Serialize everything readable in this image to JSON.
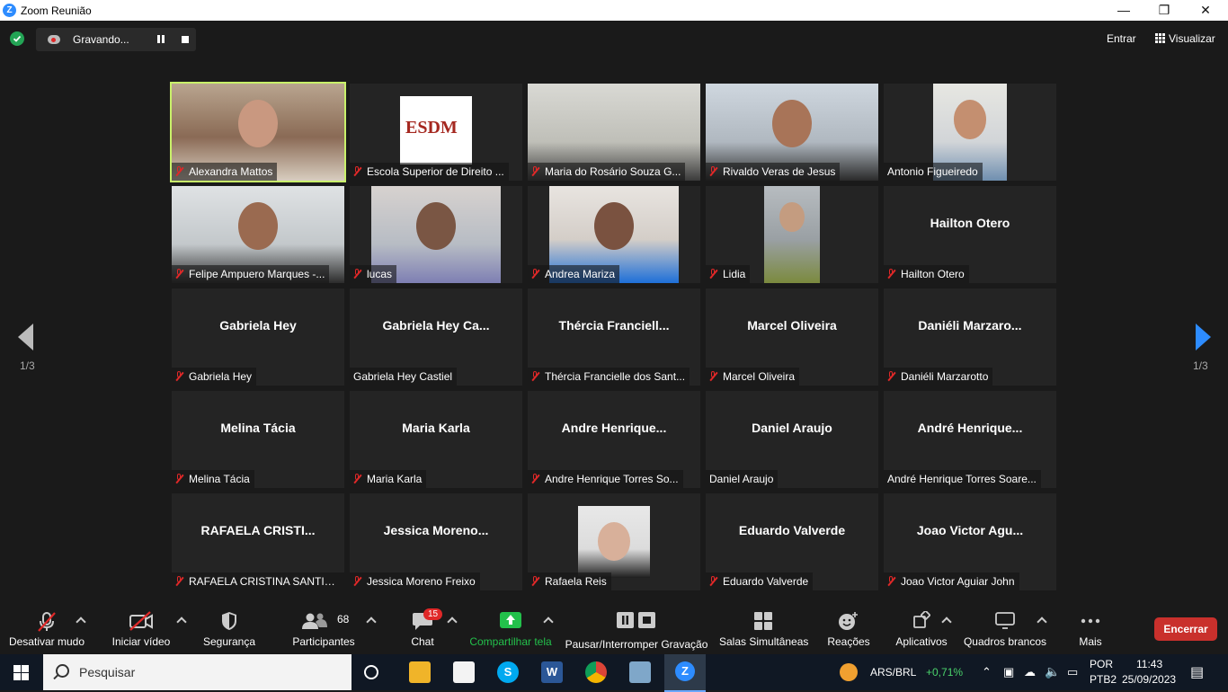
{
  "window": {
    "title": "Zoom Reunião"
  },
  "topbar": {
    "recording_label": "Gravando...",
    "enter_label": "Entrar",
    "view_label": "Visualizar"
  },
  "pagination": {
    "left": "1/3",
    "right": "1/3"
  },
  "participants": [
    {
      "big": "",
      "label": "Alexandra Mattos",
      "muted": true
    },
    {
      "big": "",
      "label": "Escola Superior de Direito ...",
      "muted": true
    },
    {
      "big": "",
      "label": "Maria do Rosário Souza G...",
      "muted": true
    },
    {
      "big": "",
      "label": "Rivaldo Veras de Jesus",
      "muted": true
    },
    {
      "big": "",
      "label": "Antonio Figueiredo",
      "muted": false
    },
    {
      "big": "",
      "label": "Felipe Ampuero Marques -...",
      "muted": true
    },
    {
      "big": "",
      "label": "lucas",
      "muted": true
    },
    {
      "big": "",
      "label": "Andrea Mariza",
      "muted": true
    },
    {
      "big": "",
      "label": "Lidia",
      "muted": true
    },
    {
      "big": "Hailton Otero",
      "label": "Hailton Otero",
      "muted": true
    },
    {
      "big": "Gabriela Hey",
      "label": "Gabriela Hey",
      "muted": true
    },
    {
      "big": "Gabriela  Hey  Ca...",
      "label": "Gabriela Hey Castiel",
      "muted": false
    },
    {
      "big": "Thércia  Franciell...",
      "label": "Thércia Francielle dos Sant...",
      "muted": true
    },
    {
      "big": "Marcel Oliveira",
      "label": "Marcel Oliveira",
      "muted": true
    },
    {
      "big": "Daniéli  Marzaro...",
      "label": "Daniéli Marzarotto",
      "muted": true
    },
    {
      "big": "Melina Tácia",
      "label": "Melina Tácia",
      "muted": true
    },
    {
      "big": "Maria Karla",
      "label": "Maria Karla",
      "muted": true
    },
    {
      "big": "Andre  Henrique...",
      "label": "Andre Henrique Torres So...",
      "muted": true
    },
    {
      "big": "Daniel Araujo",
      "label": "Daniel Araujo",
      "muted": false
    },
    {
      "big": "André  Henrique...",
      "label": "André Henrique Torres Soare...",
      "muted": false
    },
    {
      "big": "RAFAELA  CRISTI...",
      "label": "RAFAELA CRISTINA SANTIA...",
      "muted": true
    },
    {
      "big": "Jessica  Moreno...",
      "label": "Jessica Moreno Freixo",
      "muted": true
    },
    {
      "big": "",
      "label": "Rafaela Reis",
      "muted": true
    },
    {
      "big": "Eduardo Valverde",
      "label": "Eduardo Valverde",
      "muted": true
    },
    {
      "big": "Joao Victor  Agu...",
      "label": "Joao Victor Aguiar John",
      "muted": true
    }
  ],
  "esdm_logo_text": "ESDM",
  "toolbar": {
    "unmute": "Desativar mudo",
    "start_video": "Iniciar vídeo",
    "security": "Segurança",
    "participants": "Participantes",
    "participants_count": "68",
    "chat": "Chat",
    "chat_badge": "15",
    "share": "Compartilhar tela",
    "pause_recording": "Pausar/Interromper Gravação",
    "breakout": "Salas Simultâneas",
    "reactions": "Reações",
    "apps": "Aplicativos",
    "whiteboards": "Quadros brancos",
    "more": "Mais",
    "end": "Encerrar"
  },
  "taskbar": {
    "search_placeholder": "Pesquisar",
    "ticker": "ARS/BRL",
    "ticker_change": "+0,71%",
    "lang1": "POR",
    "lang2": "PTB2",
    "time": "11:43",
    "date": "25/09/2023"
  },
  "colors": {
    "active_speaker": "#c9f06a",
    "share_green": "#23c04b",
    "end_red": "#c9302c",
    "nav_blue": "#2d8cff"
  }
}
